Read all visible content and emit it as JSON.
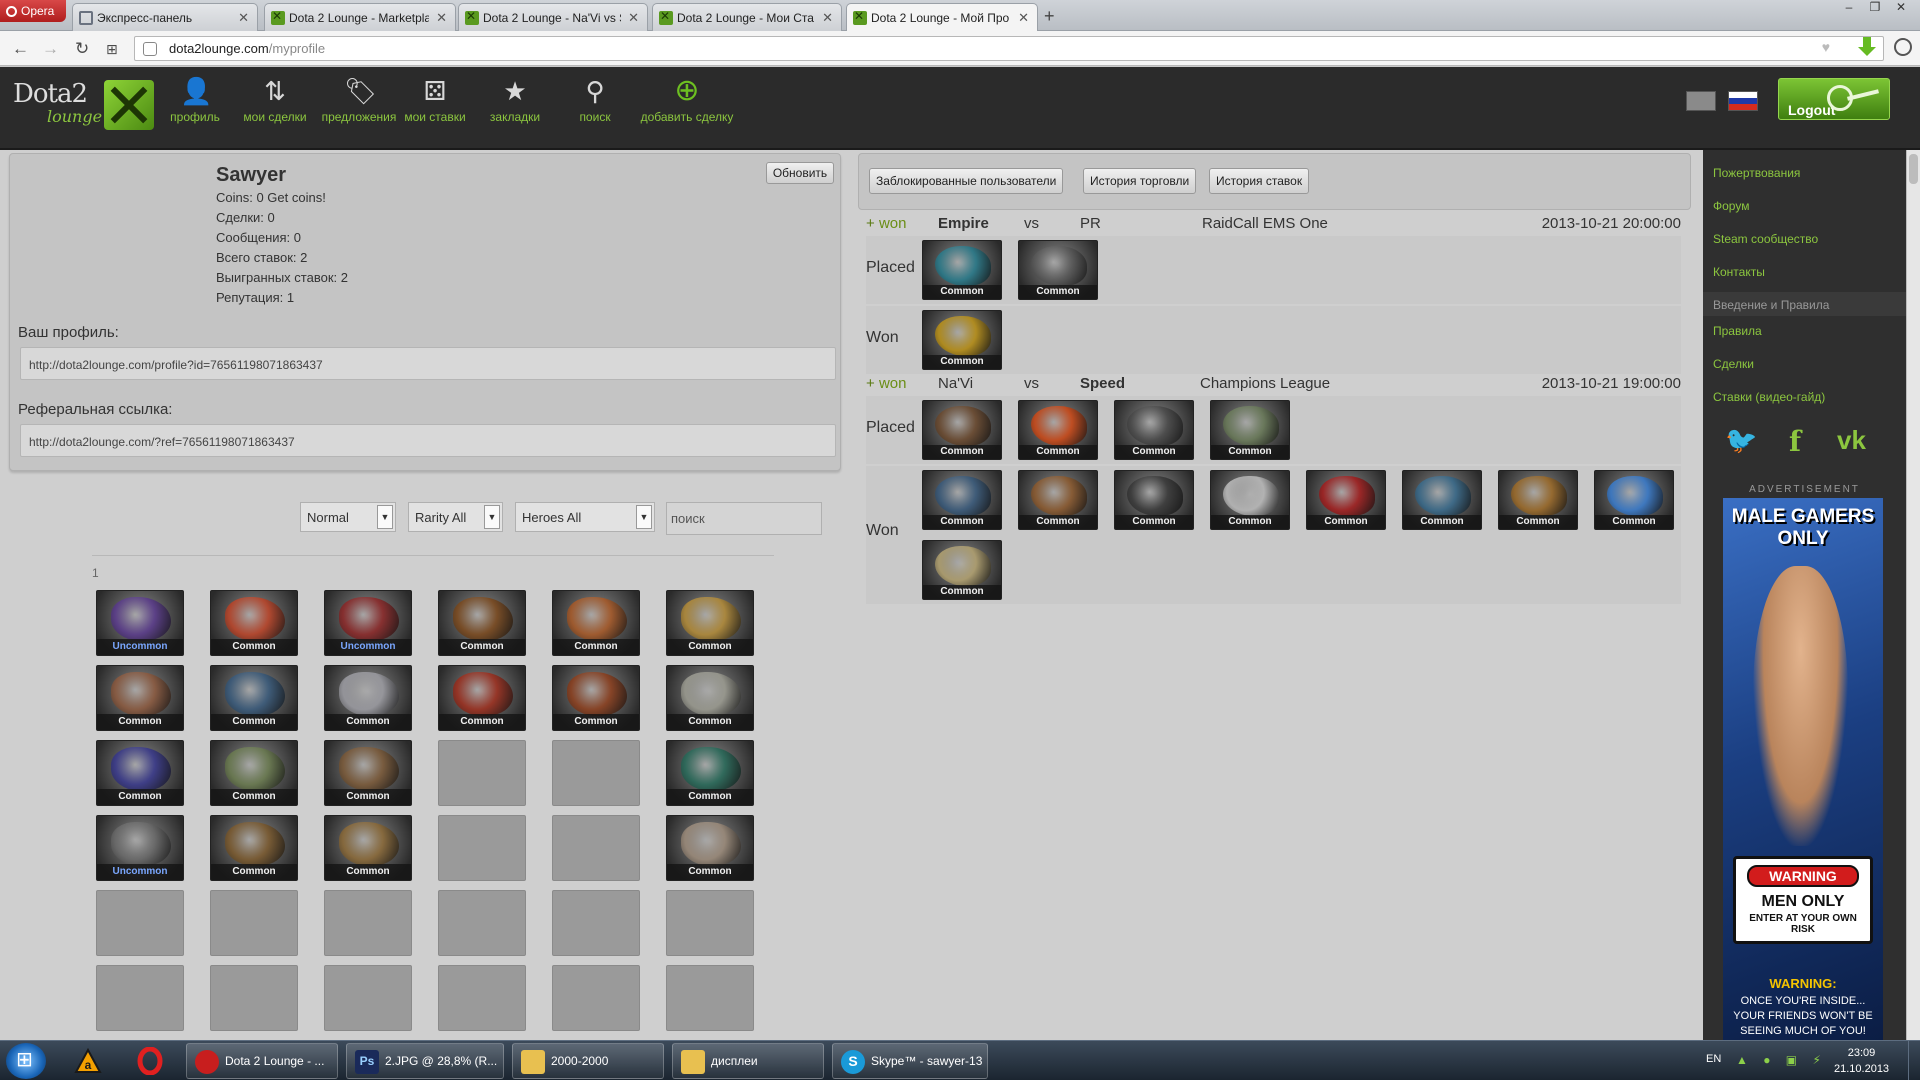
{
  "browser": {
    "menu_label": "Opera",
    "tabs": [
      {
        "label": "Экспресс-панель",
        "icon": "grid-icon"
      },
      {
        "label": "Dota 2 Lounge - Marketpla",
        "icon": "dota2lounge-favicon"
      },
      {
        "label": "Dota 2 Lounge - Na'Vi vs S",
        "icon": "dota2lounge-favicon"
      },
      {
        "label": "Dota 2 Lounge - Мои Ста",
        "icon": "dota2lounge-favicon"
      },
      {
        "label": "Dota 2 Lounge - Мой Про",
        "icon": "dota2lounge-favicon",
        "active": true
      }
    ],
    "url_domain": "dota2lounge.com",
    "url_path": "/myprofile"
  },
  "site": {
    "logo_text": "Dota2",
    "logo_sub": "lounge",
    "nav": [
      {
        "label": "профиль",
        "icon": "person-icon",
        "glyph": "👤"
      },
      {
        "label": "мои сделки",
        "icon": "trade-icon",
        "glyph": "⇅"
      },
      {
        "label": "предложения",
        "icon": "tag-icon",
        "glyph": "🏷"
      },
      {
        "label": "мои ставки",
        "icon": "dice-icon",
        "glyph": "⚄"
      },
      {
        "label": "закладки",
        "icon": "star-icon",
        "glyph": "★"
      },
      {
        "label": "поиск",
        "icon": "search-icon",
        "glyph": "⚲"
      },
      {
        "label": "добавить сделку",
        "icon": "plus-circle-icon",
        "glyph": "⊕"
      }
    ],
    "logout_label": "Logout"
  },
  "profile": {
    "name": "Sawyer",
    "coins": "Coins: 0 Get coins!",
    "trades": "Сделки: 0",
    "messages": "Сообщения: 0",
    "total_bets": "Всего ставок: 2",
    "won_bets": "Выигранных ставок: 2",
    "reputation": "Репутация: 1",
    "refresh_label": "Обновить",
    "profile_label": "Ваш профиль:",
    "profile_url": "http://dota2lounge.com/profile?id=76561198071863437",
    "ref_label": "Реферальная ссылка:",
    "ref_url": "http://dota2lounge.com/?ref=76561198071863437"
  },
  "filters": {
    "quality": "Normal",
    "rarity": "Rarity All",
    "heroes": "Heroes All",
    "search_placeholder": "поиск",
    "page": "1"
  },
  "inventory": {
    "items": [
      {
        "rarity": "Uncommon",
        "color": "#5a3c8a"
      },
      {
        "rarity": "Common",
        "color": "#b8452a"
      },
      {
        "rarity": "Uncommon",
        "color": "#8a2a2a"
      },
      {
        "rarity": "Common",
        "color": "#7a4a20"
      },
      {
        "rarity": "Common",
        "color": "#a55a2a"
      },
      {
        "rarity": "Common",
        "color": "#b08a3a"
      },
      {
        "rarity": "Common",
        "color": "#8a5a40"
      },
      {
        "rarity": "Common",
        "color": "#3a5a7a"
      },
      {
        "rarity": "Common",
        "color": "#9a9aa0"
      },
      {
        "rarity": "Common",
        "color": "#9a3020"
      },
      {
        "rarity": "Common",
        "color": "#8a4020"
      },
      {
        "rarity": "Common",
        "color": "#9a9a90"
      },
      {
        "rarity": "Common",
        "color": "#3a3a8a"
      },
      {
        "rarity": "Common",
        "color": "#6a7a50"
      },
      {
        "rarity": "Common",
        "color": "#7a5a3a"
      },
      {
        "rarity": "",
        "color": ""
      },
      {
        "rarity": "",
        "color": ""
      },
      {
        "rarity": "Common",
        "color": "#2a6a5a"
      },
      {
        "rarity": "Uncommon",
        "color": "#6a6a6a"
      },
      {
        "rarity": "Common",
        "color": "#7a5a30"
      },
      {
        "rarity": "Common",
        "color": "#8a6a3a"
      },
      {
        "rarity": "",
        "color": ""
      },
      {
        "rarity": "",
        "color": ""
      },
      {
        "rarity": "Common",
        "color": "#9a8a7a"
      }
    ]
  },
  "bets_panel": {
    "buttons": [
      "Заблокированные пользователи",
      "История торговли",
      "История ставок"
    ],
    "placed_label": "Placed",
    "won_label": "Won",
    "bets": [
      {
        "result_prefix": "+",
        "result": "won",
        "team1": "Empire",
        "vs": "vs",
        "team2": "PR",
        "event": "RaidCall EMS One",
        "date": "2013-10-21 20:00:00",
        "winner": 1,
        "placed": [
          {
            "rarity": "Common",
            "color": "#2a7a8a"
          },
          {
            "rarity": "Common",
            "color": "#5a5a5a"
          }
        ],
        "won": [
          {
            "rarity": "Common",
            "color": "#b8901a"
          }
        ]
      },
      {
        "result_prefix": "+",
        "result": "won",
        "team1": "Na'Vi",
        "vs": "vs",
        "team2": "Speed",
        "event": "Champions League",
        "date": "2013-10-21 19:00:00",
        "winner": 2,
        "placed": [
          {
            "rarity": "Common",
            "color": "#6a4a30"
          },
          {
            "rarity": "Common",
            "color": "#c84a1a"
          },
          {
            "rarity": "Common",
            "color": "#4a4a4a"
          },
          {
            "rarity": "Common",
            "color": "#6a7a5a"
          }
        ],
        "won": [
          {
            "rarity": "Common",
            "color": "#3a5a7a"
          },
          {
            "rarity": "Common",
            "color": "#8a5a30"
          },
          {
            "rarity": "Common",
            "color": "#3a3a3a"
          },
          {
            "rarity": "Common",
            "color": "#bababa"
          },
          {
            "rarity": "Common",
            "color": "#a02020"
          },
          {
            "rarity": "Common",
            "color": "#3a6a8a"
          },
          {
            "rarity": "Common",
            "color": "#9a6a2a"
          },
          {
            "rarity": "Common",
            "color": "#3a7ac8"
          },
          {
            "rarity": "Common",
            "color": "#b0a070"
          }
        ]
      }
    ]
  },
  "sidebar": {
    "links_top": [
      "Пожертвования",
      "Форум",
      "Steam сообщество",
      "Контакты"
    ],
    "heading": "Введение и Правила",
    "links_bottom": [
      "Правила",
      "Сделки",
      "Ставки (видео-гайд)"
    ],
    "social": [
      {
        "icon": "twitter-icon",
        "glyph": "🐦"
      },
      {
        "icon": "facebook-icon",
        "glyph": "f"
      },
      {
        "icon": "vk-icon",
        "glyph": "vk"
      }
    ],
    "ad_label": "ADVERTISEMENT",
    "ad": {
      "headline_1": "MALE GAMERS",
      "headline_2": "ONLY",
      "warning_pill": "WARNING",
      "men_only": "MEN ONLY",
      "risk": "ENTER AT YOUR OWN RISK",
      "warning_2": "WARNING:",
      "warning_3a": "ONCE YOU'RE INSIDE...",
      "warning_3b": "YOUR FRIENDS WON'T BE",
      "warning_3c": "SEEING MUCH OF YOU!"
    }
  },
  "taskbar": {
    "buttons": [
      {
        "label": "Dota 2 Lounge - ...",
        "icon": "opera-icon",
        "color": "#c81e1e"
      },
      {
        "label": "2.JPG @ 28,8% (R...",
        "icon": "photoshop-icon",
        "color": "#1a2a5a"
      },
      {
        "label": "2000-2000",
        "icon": "folder-icon",
        "color": "#e8c050"
      },
      {
        "label": "дисплеи",
        "icon": "folder-icon",
        "color": "#e8c050"
      },
      {
        "label": "Skype™ - sawyer-13",
        "icon": "skype-icon",
        "color": "#1a9ad8"
      }
    ],
    "lang": "EN",
    "time": "23:09",
    "date": "21.10.2013"
  }
}
